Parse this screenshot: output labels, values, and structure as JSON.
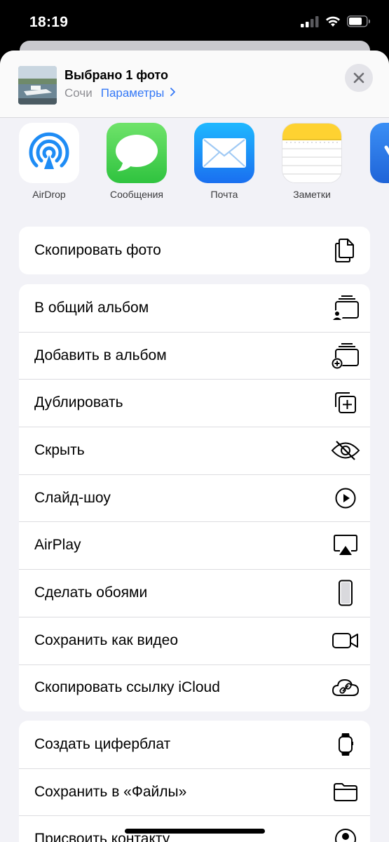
{
  "status": {
    "time": "18:19"
  },
  "header": {
    "title": "Выбрано 1 фото",
    "location": "Сочи",
    "options_link": "Параметры"
  },
  "apps": [
    {
      "label": "AirDrop",
      "icon": "airdrop-icon"
    },
    {
      "label": "Сообщения",
      "icon": "messages-icon"
    },
    {
      "label": "Почта",
      "icon": "mail-icon"
    },
    {
      "label": "Заметки",
      "icon": "notes-icon"
    }
  ],
  "actions": {
    "copy_photo": "Скопировать фото",
    "shared_album": "В общий альбом",
    "add_to_album": "Добавить в альбом",
    "duplicate": "Дублировать",
    "hide": "Скрыть",
    "slideshow": "Слайд-шоу",
    "airplay": "AirPlay",
    "wallpaper": "Сделать обоями",
    "save_video": "Сохранить как видео",
    "copy_icloud": "Скопировать ссылку iCloud",
    "watch_face": "Создать циферблат",
    "save_files": "Сохранить в «Файлы»",
    "assign_contact": "Присвоить контакту"
  },
  "colors": {
    "accent": "#3478f6",
    "sheet_bg": "#f2f2f7"
  }
}
